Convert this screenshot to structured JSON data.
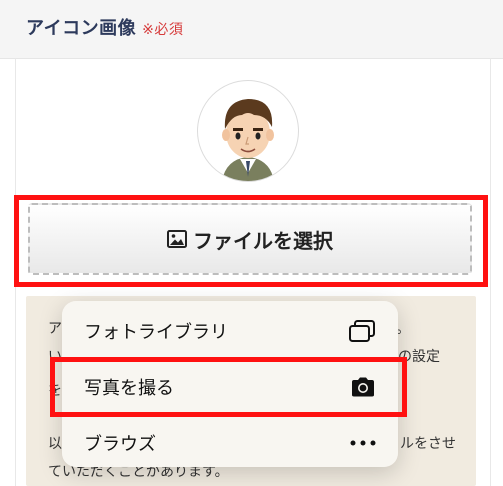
{
  "field": {
    "title": "アイコン画像",
    "required": "※必須"
  },
  "upload": {
    "button_label": "ファイルを選択",
    "button_icon": "image-icon"
  },
  "notice": {
    "line1_start": "ア",
    "line1_end": "。",
    "line2_start": "い",
    "line2_end": "の設定",
    "line3_start": "を",
    "line4_start": "以",
    "line4_end": "ルをさせ",
    "line5": "ていただくことがあります。"
  },
  "menu": {
    "items": [
      {
        "label": "フォトライブラリ",
        "icon": "photo-library-icon"
      },
      {
        "label": "写真を撮る",
        "icon": "camera-icon"
      },
      {
        "label": "ブラウズ",
        "icon": "more-icon"
      }
    ]
  },
  "colors": {
    "highlight": "#ff1111",
    "title": "#2d3a5c",
    "required": "#d63a3a",
    "notice_bg": "#f1ebe0"
  }
}
